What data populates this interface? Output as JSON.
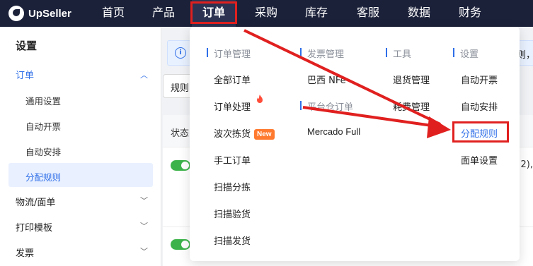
{
  "app": {
    "logo_text": "UpSeller"
  },
  "topnav": {
    "items": [
      "首页",
      "产品",
      "订单",
      "采购",
      "库存",
      "客服",
      "数据",
      "财务"
    ],
    "active": "订单"
  },
  "sidebar": {
    "title": "设置",
    "groups": [
      {
        "label": "订单",
        "expanded": true,
        "children": [
          "通用设置",
          "自动开票",
          "自动安排",
          "分配规则"
        ],
        "active_child": "分配规则"
      },
      {
        "label": "物流/面单",
        "expanded": false
      },
      {
        "label": "打印模板",
        "expanded": false
      },
      {
        "label": "发票",
        "expanded": false
      }
    ]
  },
  "content": {
    "info_text": "i 析",
    "info_right": "则，",
    "rule_select": "规则",
    "table_header_status": "状态",
    "row_tail": "2), ",
    "accent": "#2f6fe8",
    "toggle_color": "#3cb34a"
  },
  "dropdown": {
    "col1": {
      "header": "订单管理",
      "items": [
        "全部订单",
        "订单处理",
        "波次拣货",
        "手工订单",
        "扫描分拣",
        "扫描验货",
        "扫描发货"
      ],
      "new_badge": "New"
    },
    "col2": {
      "header1": "发票管理",
      "items1": [
        "巴西 NFe"
      ],
      "header2": "平台仓订单",
      "items2": [
        "Mercado Full"
      ]
    },
    "col3": {
      "header": "工具",
      "items": [
        "退货管理",
        "耗费管理"
      ]
    },
    "col4": {
      "header": "设置",
      "items": [
        "自动开票",
        "自动安排",
        "分配规则",
        "面单设置"
      ],
      "selected": "分配规则"
    }
  },
  "annotation_color": "#e0201f"
}
